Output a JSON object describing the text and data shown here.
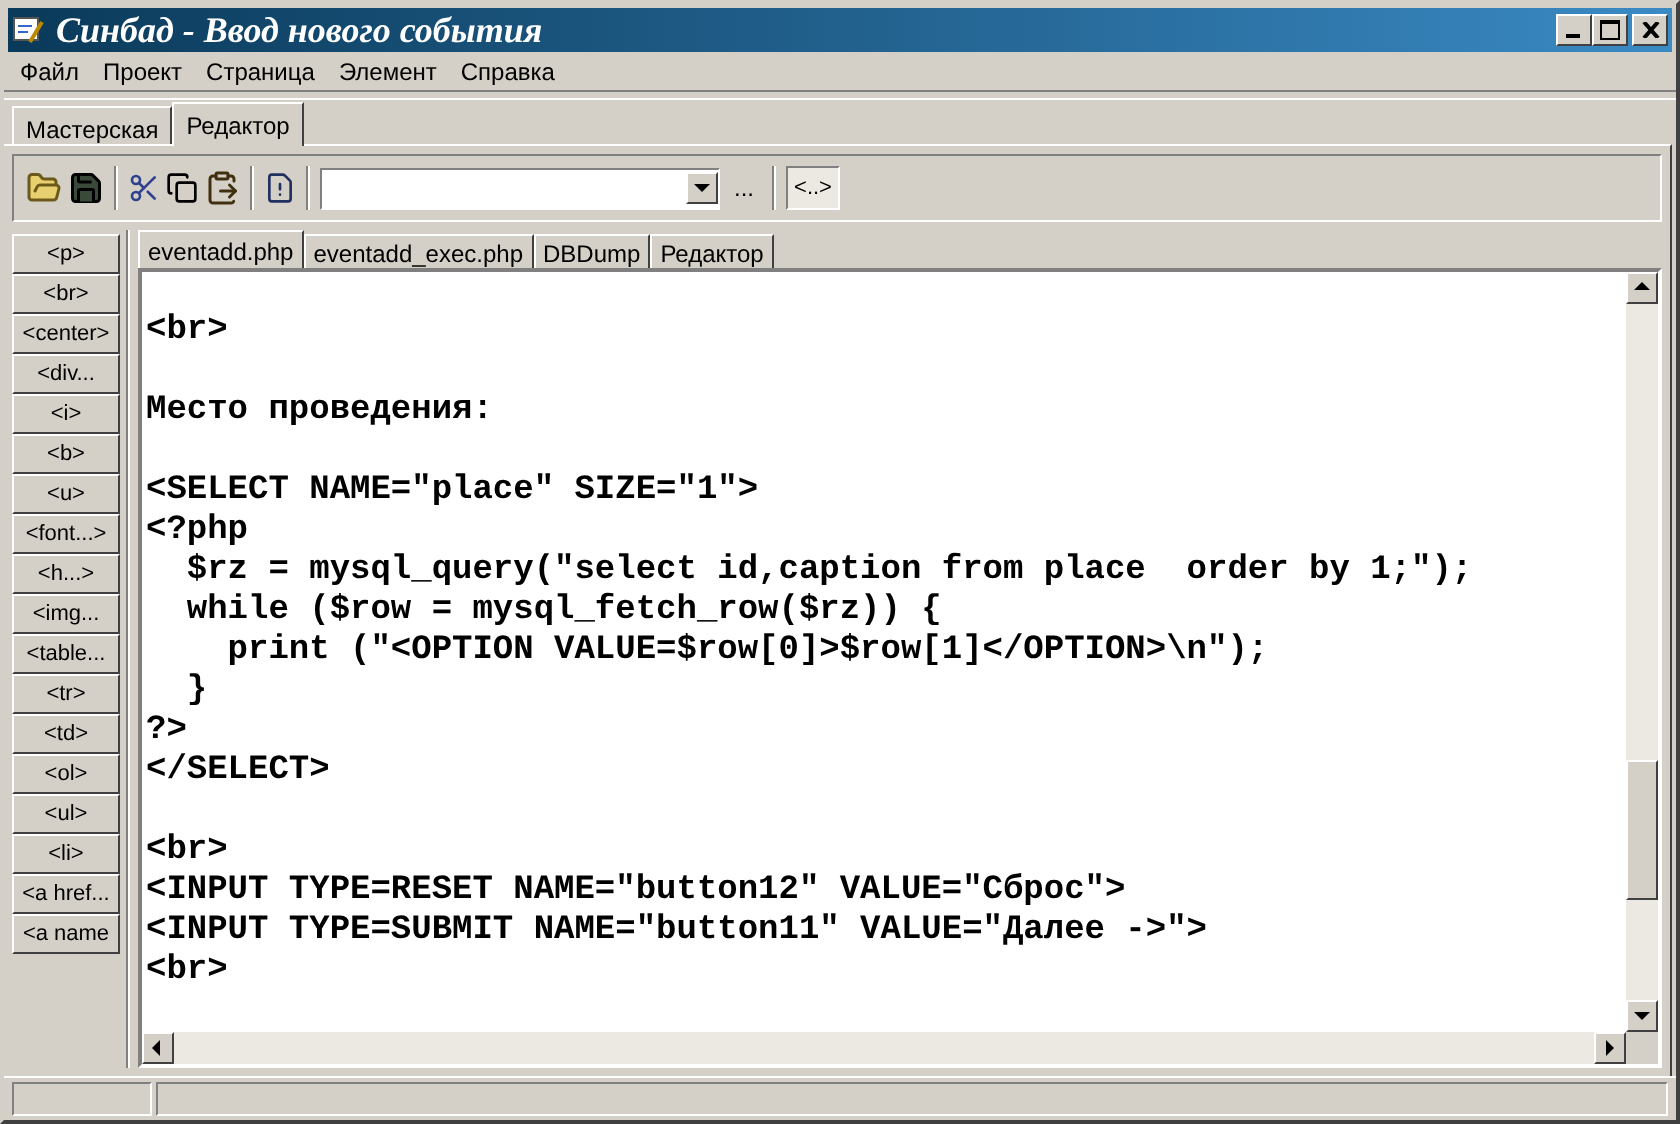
{
  "window": {
    "title": "Синбад - Ввод нового события"
  },
  "menu": [
    "Файл",
    "Проект",
    "Страница",
    "Элемент",
    "Справка"
  ],
  "mode_tabs": [
    {
      "label": "Мастерская",
      "selected": false
    },
    {
      "label": "Редактор",
      "selected": true
    }
  ],
  "toolbar": {
    "more_label": "...",
    "tag_button": {
      "label": "<..>",
      "pressed": true
    }
  },
  "tag_buttons": [
    "<p>",
    "<br>",
    "<center>",
    "<div...",
    "<i>",
    "<b>",
    "<u>",
    "<font...>",
    "<h...>",
    "<img...",
    "<table...",
    "<tr>",
    "<td>",
    "<ol>",
    "<ul>",
    "<li>",
    "<a href...",
    "<a name"
  ],
  "file_tabs": [
    {
      "label": "eventadd.php",
      "selected": true
    },
    {
      "label": "eventadd_exec.php",
      "selected": false
    },
    {
      "label": "DBDump",
      "selected": false
    },
    {
      "label": "Редактор",
      "selected": false
    }
  ],
  "editor": {
    "blocks": [
      [
        "<br>"
      ],
      [
        "Место проведения:"
      ],
      [
        "<SELECT NAME=\"place\" SIZE=\"1\">",
        "<?php",
        "  $rz = mysql_query(\"select id,caption from place  order by 1;\");",
        "  while ($row = mysql_fetch_row($rz)) {",
        "    print (\"<OPTION VALUE=$row[0]>$row[1]</OPTION>\\n\");",
        "  }",
        "?>",
        "</SELECT>"
      ],
      [
        "<br>",
        "<INPUT TYPE=RESET NAME=\"button12\" VALUE=\"Сброс\">",
        "<INPUT TYPE=SUBMIT NAME=\"button11\" VALUE=\"Далее ->\">",
        "<br>"
      ]
    ]
  }
}
